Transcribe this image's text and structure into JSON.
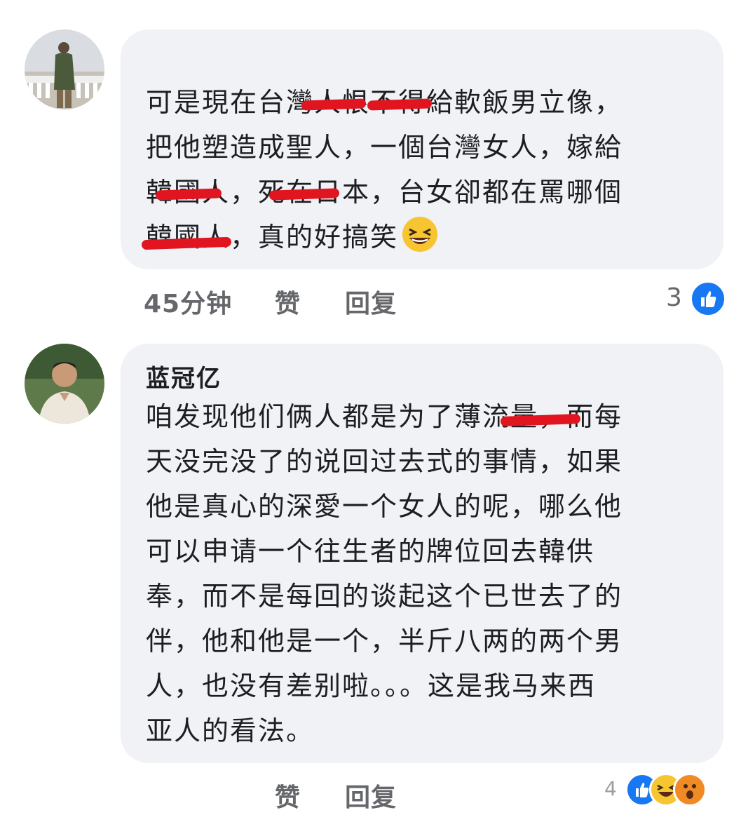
{
  "comment1": {
    "lines": [
      "可是現在台灣人恨不得給軟飯男立像，",
      "把他塑造成聖人，一個台灣女人，嫁給",
      "韓國人，死在日本，台女卻都在罵哪個",
      "韓國人，真的好搞笑"
    ],
    "time": "45分钟",
    "like_label": "赞",
    "reply_label": "回复",
    "reaction_count": "3",
    "emoji": "laughing-emoji"
  },
  "comment2": {
    "author": "蓝冠亿",
    "lines": [
      "咱发现他们俩人都是为了薄流量，而每",
      "天没完没了的说回过去式的事情，如果",
      "他是真心的深愛一个女人的呢，哪么他",
      "可以申请一个往生者的牌位回去韓供",
      "奉，而不是每回的谈起这个已世去了的",
      "伴，他和他是一个，半斤八两的两个男",
      "人，也没有差别啦。。。这是我马来西",
      "亚人的看法。"
    ],
    "like_label": "赞",
    "reply_label": "回复",
    "reaction_count_partial": "4",
    "reactions": [
      "like-icon",
      "haha-icon",
      "wow-icon"
    ]
  },
  "colors": {
    "bubble": "#f0f2f5",
    "meta_text": "#65676b",
    "like_blue": "#1877f2",
    "redaction_red": "#e0151f"
  }
}
